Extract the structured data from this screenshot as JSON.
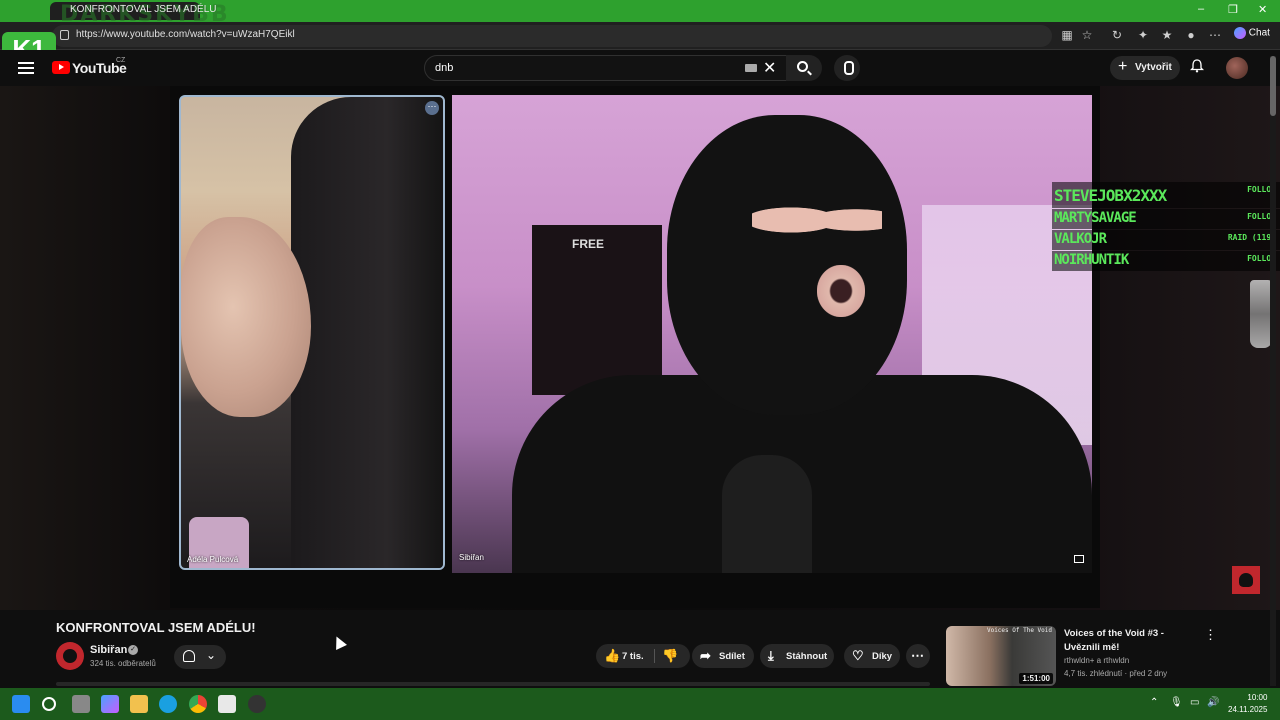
{
  "browser": {
    "tab_title": "KONFRONTOVAL JSEM ADÉLU",
    "overlay_watermark": "DARKSKYBB",
    "url": "https://www.youtube.com/watch?v=uWzaH7QEikl",
    "chat_label": "Chat",
    "k1_logo": "K1"
  },
  "youtube": {
    "logo_text": "YouTube",
    "country": "CZ",
    "search_value": "dnb",
    "create_label": "Vytvořit"
  },
  "player": {
    "left_participant": "Adéla Pulcová",
    "right_participant": "Sibiřan",
    "poster_text": "FREE"
  },
  "overlay": {
    "follows": [
      {
        "name": "STEVEJOBX2XXX",
        "tag": "FOLLOW"
      },
      {
        "name": "MARTYSAVAGE",
        "tag": "FOLLOW"
      },
      {
        "name": "VALKOJR",
        "tag": "RAID (119)"
      },
      {
        "name": "NOIRHUNTIK",
        "tag": "FOLLOW"
      }
    ]
  },
  "video": {
    "title": "KONFRONTOVAL JSEM ADÉLU!",
    "channel": "Sibiřan",
    "subscribers": "324 tis. odběratelů",
    "likes": "7 tis.",
    "share_label": "Sdílet",
    "download_label": "Stáhnout",
    "thanks_label": "Díky"
  },
  "recommendation": {
    "title": "Voices of the Void #3 - Uvěznili mě!",
    "channel": "rthwldn+ a rthwldn",
    "meta": "4,7 tis. zhlédnutí · před 2 dny",
    "duration": "1:51:00",
    "thumb_caption": "Voices Of The Void"
  },
  "taskbar": {
    "time": "10:00",
    "date": "24.11.2025"
  }
}
